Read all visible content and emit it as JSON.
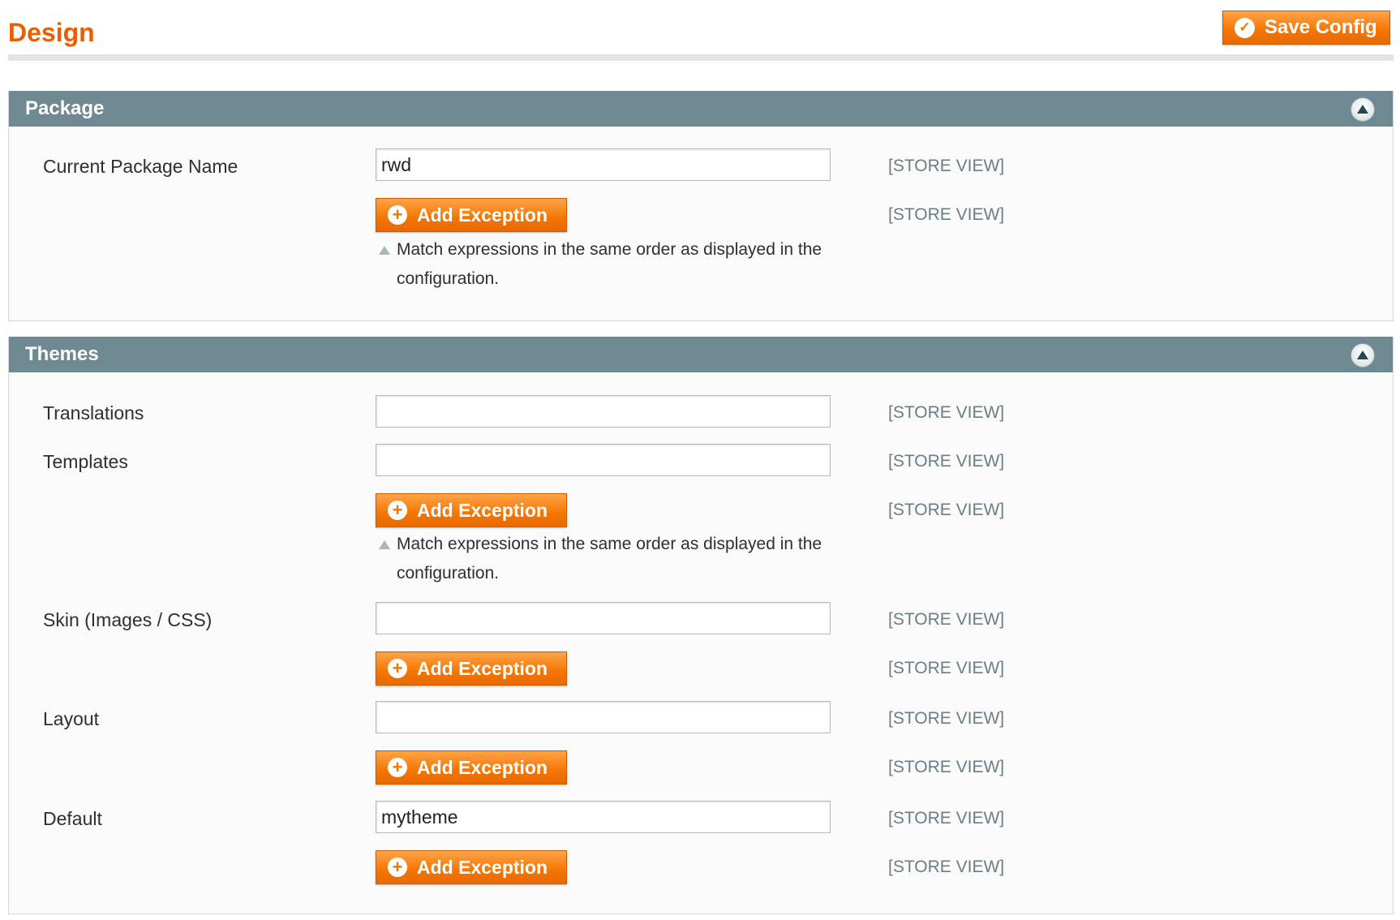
{
  "page": {
    "title": "Design"
  },
  "toolbar": {
    "save_label": "Save Config"
  },
  "scope_label": "[STORE VIEW]",
  "add_exception_label": "Add Exception",
  "note_text": "Match expressions in the same order as displayed in the configuration.",
  "package": {
    "title": "Package",
    "current_package_name": {
      "label": "Current Package Name",
      "value": "rwd"
    }
  },
  "themes": {
    "title": "Themes",
    "translations": {
      "label": "Translations",
      "value": ""
    },
    "templates": {
      "label": "Templates",
      "value": ""
    },
    "skin": {
      "label": "Skin (Images / CSS)",
      "value": ""
    },
    "layout": {
      "label": "Layout",
      "value": ""
    },
    "default": {
      "label": "Default",
      "value": "mytheme"
    }
  },
  "colors": {
    "accent": "#eb5e00",
    "button": "#f47500",
    "section_header": "#6f8992",
    "scope_text": "#6b7e85"
  }
}
